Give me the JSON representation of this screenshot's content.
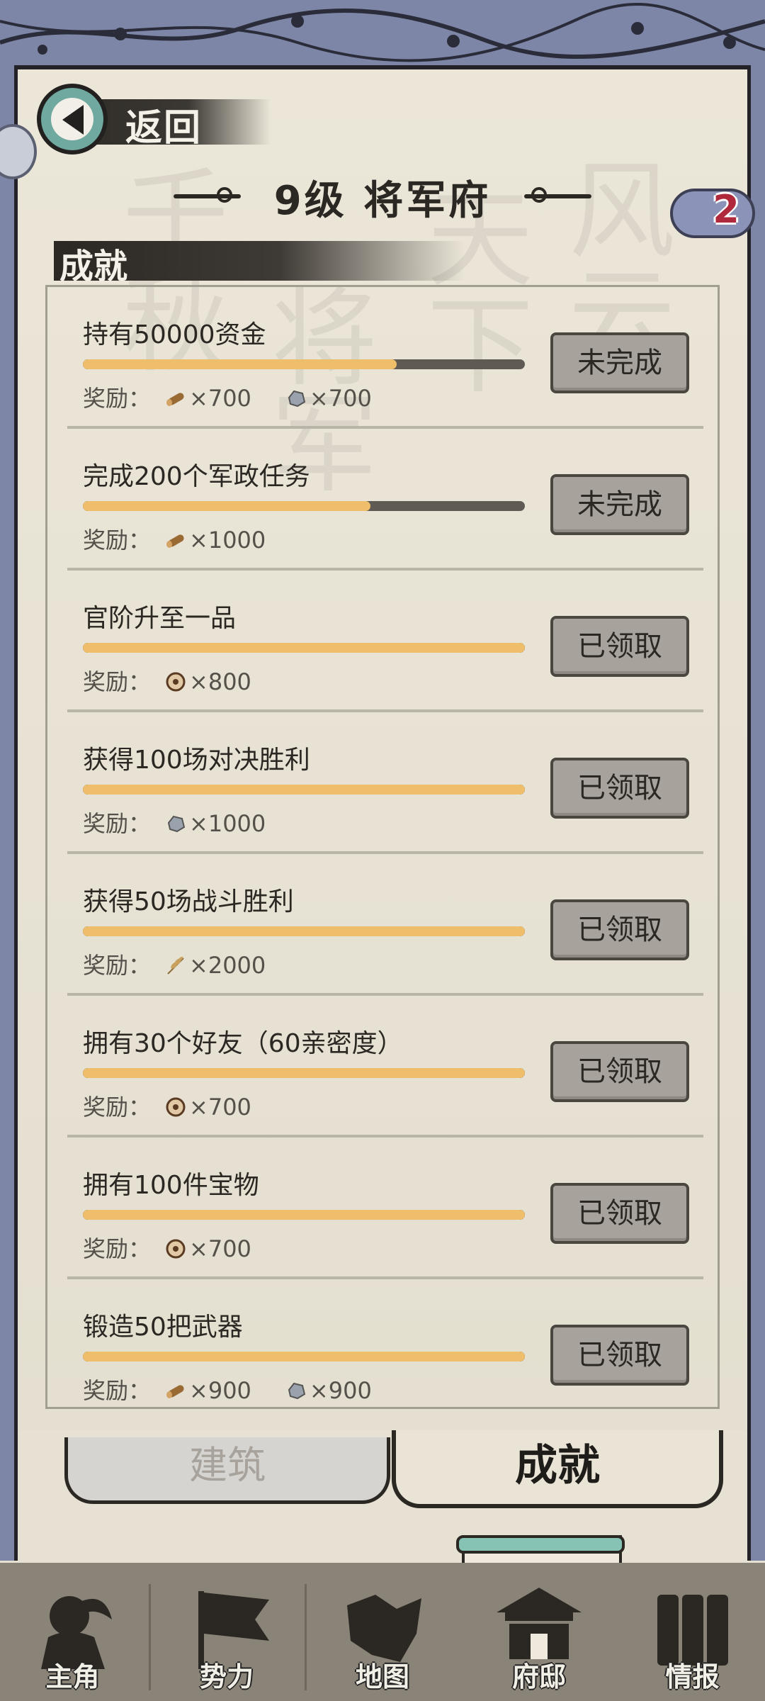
{
  "header": {
    "back_label": "返回",
    "title": "9级  将军府",
    "badge_count": "2",
    "section_label": "成就"
  },
  "achievements": [
    {
      "name": "持有50000资金",
      "progress": 0.71,
      "reward_prefix": "奖励：",
      "rewards": [
        {
          "icon": "wood-icon",
          "amount": "×700"
        },
        {
          "icon": "ore-icon",
          "amount": "×700"
        }
      ],
      "button": "未完成"
    },
    {
      "name": "完成200个军政任务",
      "progress": 0.65,
      "reward_prefix": "奖励：",
      "rewards": [
        {
          "icon": "wood-icon",
          "amount": "×1000"
        }
      ],
      "button": "未完成"
    },
    {
      "name": "官阶升至一品",
      "progress": 1.0,
      "reward_prefix": "奖励：",
      "rewards": [
        {
          "icon": "coin-icon",
          "amount": "×800"
        }
      ],
      "button": "已领取"
    },
    {
      "name": "获得100场对决胜利",
      "progress": 1.0,
      "reward_prefix": "奖励：",
      "rewards": [
        {
          "icon": "ore-icon",
          "amount": "×1000"
        }
      ],
      "button": "已领取"
    },
    {
      "name": "获得50场战斗胜利",
      "progress": 1.0,
      "reward_prefix": "奖励：",
      "rewards": [
        {
          "icon": "grain-icon",
          "amount": "×2000"
        }
      ],
      "button": "已领取"
    },
    {
      "name": "拥有30个好友（60亲密度）",
      "progress": 1.0,
      "reward_prefix": "奖励：",
      "rewards": [
        {
          "icon": "coin-icon",
          "amount": "×700"
        }
      ],
      "button": "已领取"
    },
    {
      "name": "拥有100件宝物",
      "progress": 1.0,
      "reward_prefix": "奖励：",
      "rewards": [
        {
          "icon": "coin-icon",
          "amount": "×700"
        }
      ],
      "button": "已领取"
    },
    {
      "name": "锻造50把武器",
      "progress": 1.0,
      "reward_prefix": "奖励：",
      "rewards": [
        {
          "icon": "wood-icon",
          "amount": "×900"
        },
        {
          "icon": "ore-icon",
          "amount": "×900"
        }
      ],
      "button": "已领取"
    }
  ],
  "tabs": {
    "building": "建筑",
    "achievement": "成就"
  },
  "bottom_nav": [
    {
      "label": "主角",
      "icon": "hero-icon"
    },
    {
      "label": "势力",
      "icon": "flag-icon"
    },
    {
      "label": "地图",
      "icon": "map-icon"
    },
    {
      "label": "府邸",
      "icon": "mansion-icon"
    },
    {
      "label": "情报",
      "icon": "scroll-icon"
    }
  ],
  "colors": {
    "progress_fill": "#efbe6a",
    "progress_track": "#5f5b54",
    "border_blue": "#7e86a8",
    "badge_red": "#b0283c"
  }
}
